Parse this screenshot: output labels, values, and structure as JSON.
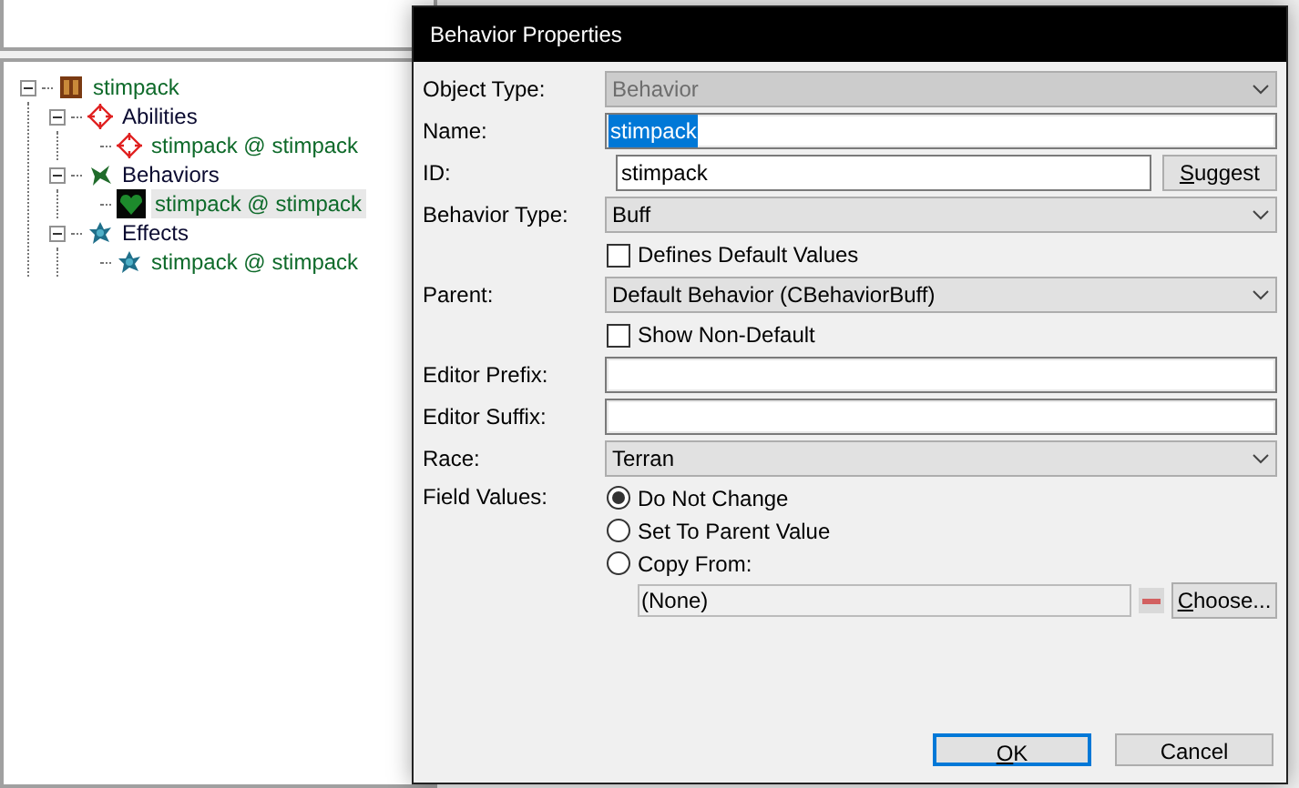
{
  "tree": [
    {
      "label": "stimpack",
      "kind": "unit",
      "expanded": true,
      "selected": false,
      "children": [
        {
          "label": "Abilities",
          "kind": "ability",
          "expanded": true,
          "selected": false,
          "children": [
            {
              "label": "stimpack @ stimpack",
              "kind": "ability",
              "selected": false
            }
          ]
        },
        {
          "label": "Behaviors",
          "kind": "behavior-folder",
          "expanded": true,
          "selected": false,
          "children": [
            {
              "label": "stimpack @ stimpack",
              "kind": "behavior",
              "selected": true
            }
          ]
        },
        {
          "label": "Effects",
          "kind": "effect",
          "expanded": true,
          "selected": false,
          "children": [
            {
              "label": "stimpack @ stimpack",
              "kind": "effect",
              "selected": false
            }
          ]
        }
      ]
    }
  ],
  "dialog": {
    "title": "Behavior Properties",
    "rows": [
      {
        "kind": "select",
        "label": "Object Type:",
        "value": "Behavior",
        "disabled": true
      },
      {
        "kind": "input",
        "label": "Name:",
        "value": "stimpack",
        "highlighted": true
      },
      {
        "kind": "input-button",
        "label": "ID:",
        "value": "stimpack",
        "button": "Suggest"
      },
      {
        "kind": "select",
        "label": "Behavior Type:",
        "value": "Buff",
        "disabled": false
      },
      {
        "kind": "checkbox",
        "text": "Defines Default Values",
        "checked": false
      },
      {
        "kind": "select",
        "label": "Parent:",
        "value": "Default Behavior (CBehaviorBuff)",
        "disabled": false
      },
      {
        "kind": "checkbox",
        "text": "Show Non-Default",
        "checked": false
      },
      {
        "kind": "input",
        "label": "Editor Prefix:"
      },
      {
        "kind": "input",
        "label": "Editor Suffix:"
      },
      {
        "kind": "select",
        "label": "Race:",
        "value": "Terran",
        "disabled": false
      }
    ],
    "field_values": {
      "label": "Field Values:",
      "options": [
        {
          "text": "Do Not Change",
          "selected": true
        },
        {
          "text": "Set To Parent Value",
          "selected": false
        },
        {
          "text": "Copy From:",
          "selected": false
        }
      ],
      "copy_value": "(None)",
      "choose_button": "Choose..."
    },
    "buttons": [
      {
        "label": "OK",
        "default": true
      },
      {
        "label": "Cancel",
        "default": false
      }
    ]
  }
}
